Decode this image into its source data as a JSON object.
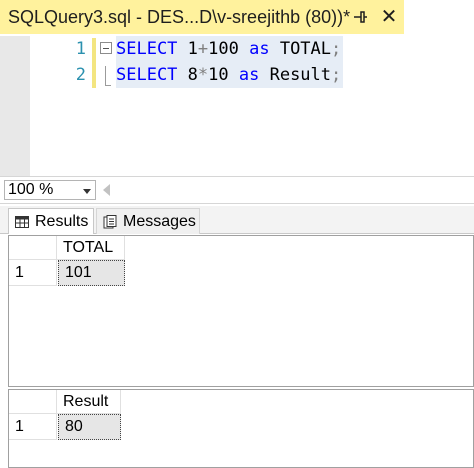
{
  "tab": {
    "title": "SQLQuery3.sql - DES...D\\v-sreejithb (80))*",
    "close_glyph": "✕"
  },
  "editor": {
    "lines": [
      {
        "number": "1",
        "tokens": [
          {
            "t": "SELECT",
            "c": "kw"
          },
          {
            "t": " 1",
            "c": "plain"
          },
          {
            "t": "+",
            "c": "op"
          },
          {
            "t": "100 ",
            "c": "plain"
          },
          {
            "t": "as",
            "c": "kw"
          },
          {
            "t": " TOTAL",
            "c": "plain"
          },
          {
            "t": ";",
            "c": "op"
          }
        ]
      },
      {
        "number": "2",
        "tokens": [
          {
            "t": "SELECT",
            "c": "kw"
          },
          {
            "t": " 8",
            "c": "plain"
          },
          {
            "t": "*",
            "c": "op"
          },
          {
            "t": "10 ",
            "c": "plain"
          },
          {
            "t": "as",
            "c": "kw"
          },
          {
            "t": " Result",
            "c": "plain"
          },
          {
            "t": ";",
            "c": "op"
          }
        ]
      }
    ]
  },
  "zoom": {
    "value": "100 %"
  },
  "results_tabs": {
    "results_label": "Results",
    "messages_label": "Messages"
  },
  "grids": [
    {
      "column": "TOTAL",
      "row_number": "1",
      "value": "101"
    },
    {
      "column": "Result",
      "row_number": "1",
      "value": "80"
    }
  ],
  "colors": {
    "tab_background": "#fff29d",
    "keyword": "#0000ff",
    "line_number": "#2b91af",
    "selection": "#e6edf6"
  }
}
